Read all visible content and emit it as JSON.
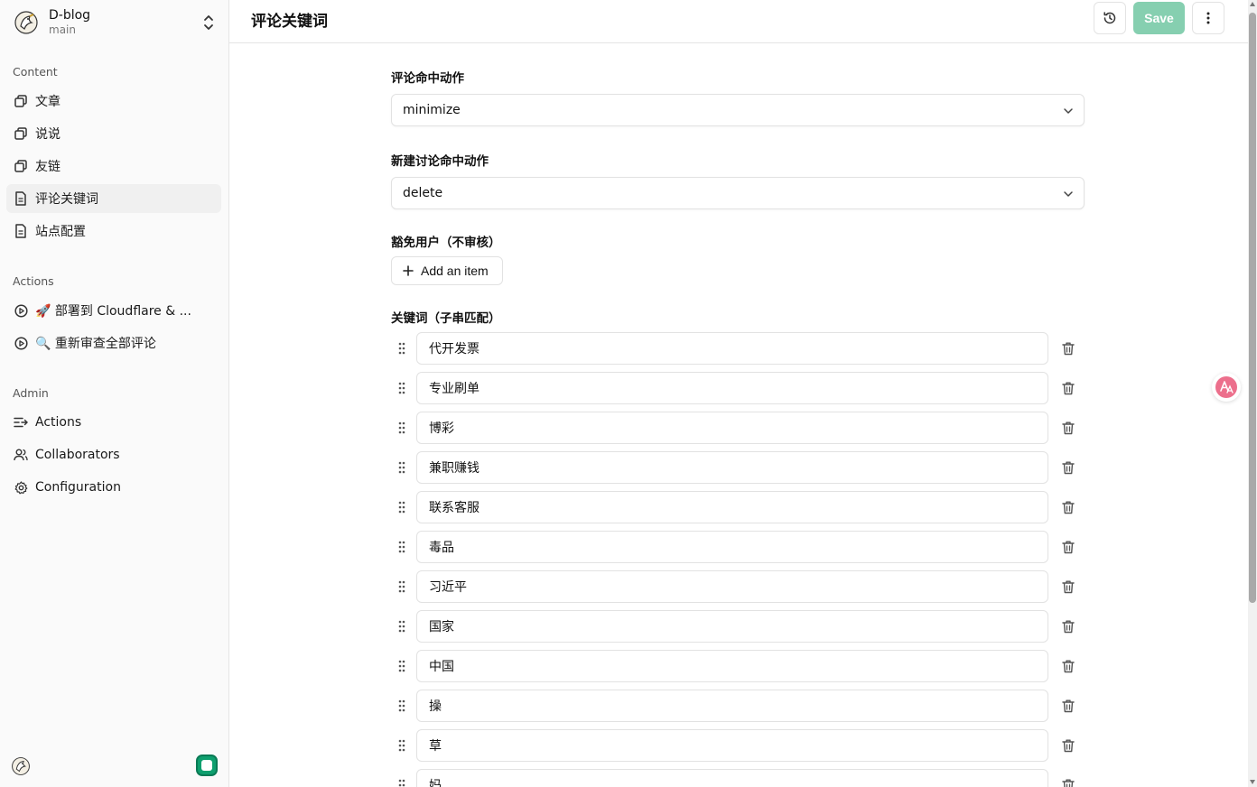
{
  "repo": {
    "name": "D-blog",
    "branch": "main"
  },
  "sidebar": {
    "content_title": "Content",
    "content_items": [
      {
        "label": "文章",
        "icon": "collection-icon"
      },
      {
        "label": "说说",
        "icon": "collection-icon"
      },
      {
        "label": "友链",
        "icon": "collection-icon"
      },
      {
        "label": "评论关键词",
        "icon": "file-icon",
        "active": true
      },
      {
        "label": "站点配置",
        "icon": "file-icon"
      }
    ],
    "actions_title": "Actions",
    "action_items": [
      {
        "label": "🚀 部署到 Cloudflare & ...",
        "icon": "play-circle-icon"
      },
      {
        "label": "🔍 重新审查全部评论",
        "icon": "play-circle-icon"
      }
    ],
    "admin_title": "Admin",
    "admin_items": [
      {
        "label": "Actions",
        "icon": "list-icon"
      },
      {
        "label": "Collaborators",
        "icon": "users-icon"
      },
      {
        "label": "Configuration",
        "icon": "gear-icon"
      }
    ]
  },
  "header": {
    "title": "评论关键词",
    "save_label": "Save"
  },
  "form": {
    "comment_action_label": "评论命中动作",
    "comment_action_value": "minimize",
    "discussion_action_label": "新建讨论命中动作",
    "discussion_action_value": "delete",
    "exempt_users_label": "豁免用户（不审核）",
    "add_item_label": "Add an item",
    "keywords_label": "关键词（子串匹配）",
    "keywords": [
      "代开发票",
      "专业刷单",
      "博彩",
      "兼职赚钱",
      "联系客服",
      "毒品",
      "习近平",
      "国家",
      "中国",
      "操",
      "草",
      "妈"
    ]
  },
  "colors": {
    "accent": "#0e9f6e",
    "save_disabled": "#86cfb0"
  }
}
